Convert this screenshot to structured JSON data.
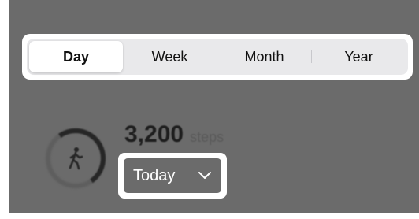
{
  "tabs": [
    {
      "label": "Day",
      "selected": true
    },
    {
      "label": "Week",
      "selected": false
    },
    {
      "label": "Month",
      "selected": false
    },
    {
      "label": "Year",
      "selected": false
    }
  ],
  "summary": {
    "steps_value": "3,200",
    "steps_unit": "steps",
    "icon": "walking-person-icon"
  },
  "date_filter": {
    "label": "Today",
    "icon": "chevron-down-icon"
  }
}
